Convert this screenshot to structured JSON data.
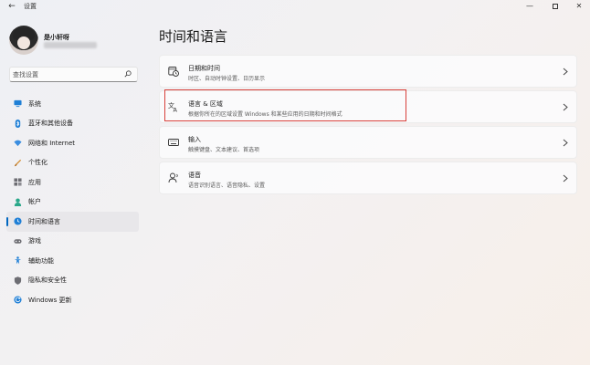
{
  "window": {
    "back_glyph": "←",
    "title": "设置",
    "minimize_glyph": "—",
    "close_glyph": "✕"
  },
  "user": {
    "name": "是小轩呀"
  },
  "search": {
    "placeholder": "查找设置"
  },
  "sidebar": {
    "items": [
      {
        "label": "系统",
        "icon": "monitor-icon",
        "color": "#1f7fd6"
      },
      {
        "label": "蓝牙和其他设备",
        "icon": "bluetooth-icon",
        "color": "#1f7fd6"
      },
      {
        "label": "网络和 Internet",
        "icon": "wifi-icon",
        "color": "#3a8de0"
      },
      {
        "label": "个性化",
        "icon": "brush-icon",
        "color": "#d38a2c"
      },
      {
        "label": "应用",
        "icon": "apps-icon",
        "color": "#6d6d73"
      },
      {
        "label": "帐户",
        "icon": "person-icon",
        "color": "#2aa88a"
      },
      {
        "label": "时间和语言",
        "icon": "globe-clock-icon",
        "color": "#1f7fd6",
        "active": true
      },
      {
        "label": "游戏",
        "icon": "gamepad-icon",
        "color": "#6d6d73"
      },
      {
        "label": "辅助功能",
        "icon": "accessibility-icon",
        "color": "#1f7fd6"
      },
      {
        "label": "隐私和安全性",
        "icon": "shield-icon",
        "color": "#6d6d73"
      },
      {
        "label": "Windows 更新",
        "icon": "update-icon",
        "color": "#1f7fd6"
      }
    ]
  },
  "page": {
    "title": "时间和语言"
  },
  "cards": [
    {
      "title": "日期和时间",
      "desc": "时区、自动时钟设置、日历显示",
      "icon": "calendar-clock-icon"
    },
    {
      "title": "语言 & 区域",
      "desc": "根据你所在的区域设置 Windows 和某些应用的日期和时间格式",
      "icon": "language-icon"
    },
    {
      "title": "输入",
      "desc": "触摸键盘、文本建议、首选项",
      "icon": "keyboard-icon"
    },
    {
      "title": "语音",
      "desc": "语音识别语言、语音隐私、设置",
      "icon": "speech-icon"
    }
  ],
  "colors": {
    "accent": "#0067c0",
    "highlight_border": "#d8403a"
  }
}
